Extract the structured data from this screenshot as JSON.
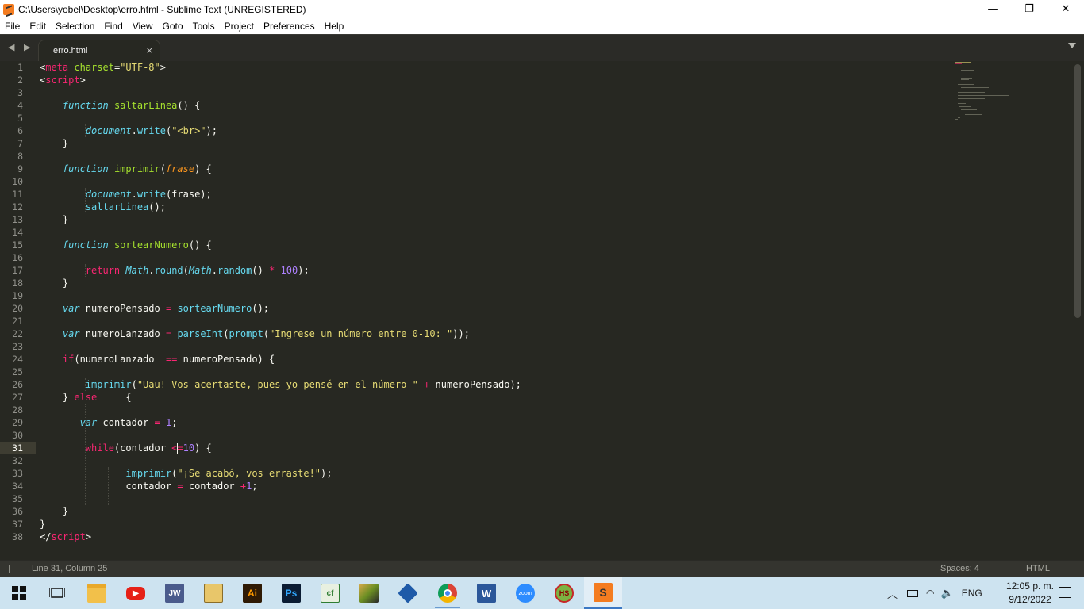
{
  "window": {
    "title": "C:\\Users\\yobel\\Desktop\\erro.html - Sublime Text (UNREGISTERED)",
    "controls": {
      "minimize": "—",
      "restore": "❐",
      "close": "✕"
    }
  },
  "menu": [
    "File",
    "Edit",
    "Selection",
    "Find",
    "View",
    "Goto",
    "Tools",
    "Project",
    "Preferences",
    "Help"
  ],
  "tab": {
    "label": "erro.html",
    "close": "×"
  },
  "nav_arrows": "◀ ▶",
  "editor": {
    "active_line": 31,
    "line_numbers": [
      "1",
      "2",
      "3",
      "4",
      "5",
      "6",
      "7",
      "8",
      "9",
      "10",
      "11",
      "12",
      "13",
      "14",
      "15",
      "16",
      "17",
      "18",
      "19",
      "20",
      "21",
      "22",
      "23",
      "24",
      "25",
      "26",
      "27",
      "28",
      "29",
      "30",
      "31",
      "32",
      "33",
      "34",
      "35",
      "36",
      "37",
      "38"
    ]
  },
  "statusbar": {
    "position": "Line 31, Column 25",
    "indentation": "Spaces: 4",
    "syntax": "HTML"
  },
  "taskbar": {
    "apps": [
      {
        "name": "start",
        "label": ""
      },
      {
        "name": "task-view",
        "label": ""
      },
      {
        "name": "file-explorer",
        "label": ""
      },
      {
        "name": "youtube",
        "label": ""
      },
      {
        "name": "jw",
        "label": "JW"
      },
      {
        "name": "folder-app",
        "label": ""
      },
      {
        "name": "illustrator",
        "label": "Ai"
      },
      {
        "name": "photoshop",
        "label": "Ps"
      },
      {
        "name": "cf-app",
        "label": "cf"
      },
      {
        "name": "paint-app",
        "label": ""
      },
      {
        "name": "virtualbox",
        "label": ""
      },
      {
        "name": "chrome",
        "label": ""
      },
      {
        "name": "word",
        "label": "W"
      },
      {
        "name": "zoom",
        "label": "zoom"
      },
      {
        "name": "hs-app",
        "label": "HS"
      },
      {
        "name": "sublime",
        "label": "S"
      }
    ],
    "tray": {
      "language": "ENG"
    },
    "clock": {
      "time": "12:05 p. m.",
      "date": "9/12/2022"
    }
  },
  "colors": {
    "editor_bg": "#272822",
    "keyword": "#f92672",
    "storage": "#66d9ef",
    "function": "#a6e22e",
    "string": "#e6db74",
    "number": "#ae81ff",
    "parameter": "#fd971f"
  }
}
